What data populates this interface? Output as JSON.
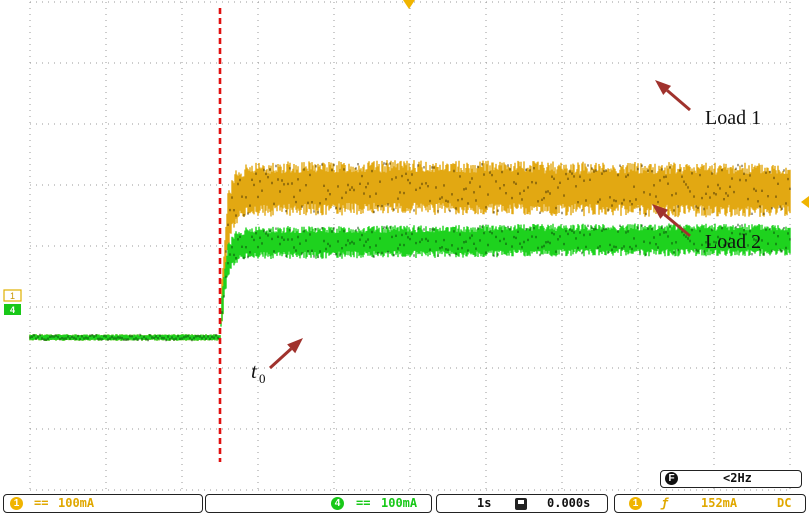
{
  "chart_data": {
    "type": "line",
    "x": [
      0,
      0.5,
      1,
      1.5,
      2,
      2.5,
      3,
      3.5,
      4,
      4.5,
      5,
      5.5,
      6,
      6.5,
      7,
      7.5,
      8,
      8.5,
      9,
      9.5,
      10
    ],
    "series": [
      {
        "name": "Load 1",
        "channel": "1",
        "color": "#c8960a",
        "values": [
          0,
          0,
          0,
          0,
          0,
          0,
          0,
          0,
          0,
          0,
          0,
          0,
          0,
          0,
          0,
          0,
          0,
          0,
          0,
          0,
          0
        ]
      },
      {
        "name": "Load 2",
        "channel": "4",
        "color": "#18c818",
        "values": [
          0,
          0,
          0,
          0,
          0,
          0,
          0,
          0,
          0,
          0,
          0,
          0,
          0,
          0,
          0,
          0,
          0,
          0,
          0,
          0,
          0
        ]
      }
    ],
    "load1_response": {
      "t": [
        2.5,
        2.55,
        2.6,
        2.7,
        2.8,
        3.0,
        3.3,
        3.6,
        4,
        5,
        6,
        7,
        8,
        9,
        10
      ],
      "y": [
        0,
        1.0,
        1.9,
        2.3,
        2.38,
        2.42,
        2.44,
        2.45,
        2.45,
        2.46,
        2.45,
        2.44,
        2.43,
        2.42,
        2.42
      ]
    },
    "load2_response": {
      "t": [
        2.5,
        2.55,
        2.6,
        2.7,
        2.8,
        3.0,
        3.3,
        3.6,
        4,
        5,
        6,
        7,
        8,
        9,
        10
      ],
      "y": [
        0,
        0.8,
        1.25,
        1.48,
        1.53,
        1.55,
        1.56,
        1.56,
        1.56,
        1.57,
        1.58,
        1.6,
        1.6,
        1.6,
        1.6
      ]
    },
    "t0": 2.5,
    "xlim": [
      0,
      10
    ],
    "ylim": [
      -2.5,
      5.5
    ],
    "divisions": {
      "x": 10,
      "y": 8
    },
    "grid": true,
    "annotations": [
      {
        "text": "Load 1",
        "target_series": "Load 1"
      },
      {
        "text": "Load 2",
        "target_series": "Load 2"
      },
      {
        "text": "t",
        "subscript": "0",
        "target": "t0"
      }
    ],
    "colors": {
      "trigger_line": "#e01010",
      "arrow": "#a0322d",
      "grid": "#9a9a9a"
    }
  },
  "markers": {
    "ch1": "1",
    "ch4": "4"
  },
  "status": {
    "ch1_coupling": "==",
    "ch1_scale": "100mA",
    "ch4_coupling": "==",
    "ch4_scale": "100mA",
    "ch4_label": "4",
    "ch1_label": "1",
    "timebase": "1s",
    "trigger_position": "0.000s",
    "trigger_channel": "1",
    "trigger_slope": "ƒ",
    "trigger_level": "152mA",
    "trigger_coupling": "DC",
    "freq_badge": "F",
    "frequency": "<2Hz"
  }
}
